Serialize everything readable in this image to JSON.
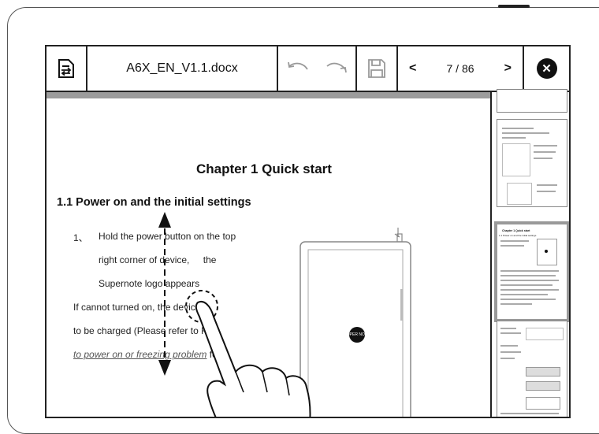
{
  "toolbar": {
    "doc_icon": "document-sync-icon",
    "filename": "A6X_EN_V1.1.docx",
    "undo_icon": "undo-icon",
    "redo_icon": "redo-icon",
    "save_icon": "save-icon",
    "prev": "<",
    "page_indicator": "7 / 86",
    "next": ">",
    "close": "✕"
  },
  "document": {
    "chapter_title": "Chapter 1 Quick start",
    "section_title": "1.1 Power on and the initial settings",
    "step_number": "1、",
    "step_line1": "Hold the power button on the top",
    "step_line2_a": "right corner of device, ",
    "step_line2_b": "the",
    "step_line3": "Supernote logo appears",
    "para_line1": "If cannot turned on, the device",
    "para_line2_a": "to be charged (Please ",
    "para_line2_b": "refer to FAQ",
    "para_line3_link": "to power on or freezing problem",
    "para_line3_rest": " fo",
    "device_logo": "SUPER NOTE"
  },
  "thumbnails": {
    "page8_heading": "Chapter 1 Quick start",
    "page8_sub": "1.1 Power on and the initial settings"
  }
}
